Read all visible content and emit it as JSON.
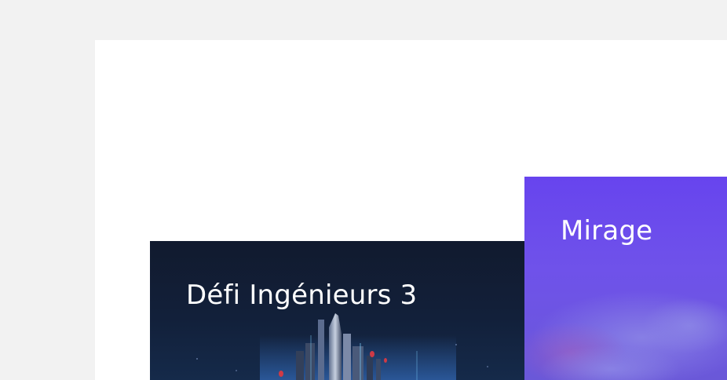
{
  "cards": [
    {
      "title": "Défi Ingénieurs 3"
    },
    {
      "title": "Mirage"
    }
  ]
}
